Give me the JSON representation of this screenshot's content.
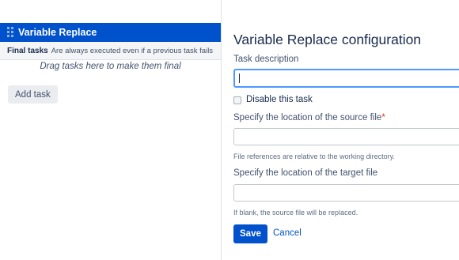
{
  "task_list": {
    "task_title": "Variable Replace",
    "final_tasks_label": "Final tasks",
    "final_tasks_description": "Are always executed even if a previous task fails",
    "drag_hint": "Drag tasks here to make them final",
    "add_task_label": "Add task"
  },
  "form": {
    "title": "Variable Replace configuration",
    "task_description_label": "Task description",
    "task_description_value": "",
    "disable_task_label": "Disable this task",
    "disable_task_checked": false,
    "source_file_label": "Specify the location of the source file",
    "source_required_marker": "*",
    "source_file_value": "",
    "source_file_help": "File references are relative to the working directory.",
    "target_file_label": "Specify the location of the target file",
    "target_file_value": "",
    "target_file_help": "If blank, the source file will be replaced.",
    "save_label": "Save",
    "cancel_label": "Cancel"
  },
  "colors": {
    "primary": "#0052cc",
    "focus": "#4c9aff",
    "required": "#de350b"
  },
  "icons": {
    "drag_handle": "grip-icon"
  }
}
